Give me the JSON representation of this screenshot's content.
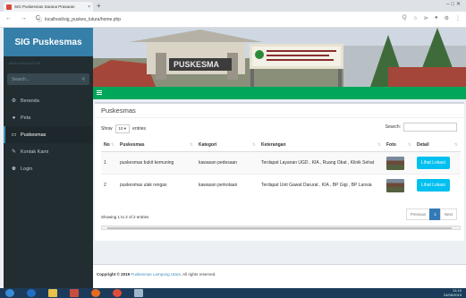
{
  "browser": {
    "tab_title": "SIG Puskesmas Sarana Prasaran",
    "close": "×",
    "new_tab": "+",
    "window_controls": "–□✕",
    "url": "localhost/sig_puskes_lutura/home.php",
    "nav": "← → C",
    "toolbar_icons": [
      "Q",
      "☆",
      "⊳",
      "●",
      "⚙",
      "⋮"
    ]
  },
  "sidebar": {
    "brand": "SIG Puskesmas",
    "nav_header": "MAIN NAVIGATION",
    "search_placeholder": "Search...",
    "search_icon": "🔍",
    "items": [
      {
        "label": "Beranda",
        "icon": "⚙",
        "active": false
      },
      {
        "label": "Peta",
        "icon": "●",
        "active": false
      },
      {
        "label": "Puskesmas",
        "icon": "▭",
        "active": true
      },
      {
        "label": "Kontak Kami",
        "icon": "✎",
        "active": false
      },
      {
        "label": "Login",
        "icon": "♚",
        "active": false
      }
    ]
  },
  "banner": {
    "sign_text": "PUSKESMA",
    "colors": {
      "sky": "#cfd8e2",
      "roof": "#a5463a",
      "trees": "#3f6b3b"
    }
  },
  "box": {
    "title": "Puskesmas",
    "show_label": "Show",
    "entries_value": "10",
    "entries_label": "entries",
    "search_label": "Search:",
    "columns": [
      "No",
      "Puskesmas",
      "Kategori",
      "Keterangan",
      "Foto",
      "Detail"
    ],
    "rows": [
      {
        "no": "1",
        "puskesmas": "puskesmas bukit kemuning",
        "kategori": "kawasan pedesaan",
        "keterangan": "Terdapat Layanan UGD , KIA , Ruang Obat , Klinik Sehat",
        "detail": "Lihat Lokasi"
      },
      {
        "no": "2",
        "puskesmas": "puskesmas ulak rengas",
        "kategori": "kawasan perkotaan",
        "keterangan": "Terdapat Unit Gawat Darurat , KIA , BP Gigi , BP Lansia",
        "detail": "Lihat Lokasi"
      }
    ],
    "info": "Showing 1 to 2 of 2 entries",
    "pager": {
      "prev": "Previous",
      "page": "1",
      "next": "Next"
    }
  },
  "footer": {
    "prefix": "Copyright © 2019",
    "link": "Puskesmas Lampung Utara.",
    "suffix": "All rights reserved."
  },
  "taskbar": {
    "time": "11:10",
    "date": "24/06/2019"
  },
  "colors": {
    "sidebar": "#222d32",
    "brand": "#367fa9",
    "green": "#00a65a",
    "button": "#00c0ef"
  }
}
